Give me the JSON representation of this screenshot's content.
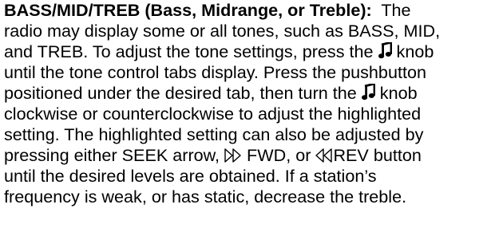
{
  "document": {
    "heading": "BASS/MID/TREB (Bass, Midrange, or Treble):",
    "line1_rest": "  The",
    "line2": "radio may display some or all tones, such as BASS, MID,",
    "line3a": "and TREB. To adjust the tone settings, press the ",
    "line3b": " knob",
    "line4": "until the tone control tabs display. Press the pushbutton",
    "line5a": "positioned under the desired tab, then turn the ",
    "line5b": " knob",
    "line6": "clockwise or counterclockwise to adjust the highlighted",
    "line7": "setting. The highlighted setting can also be adjusted by",
    "line8a": "pressing either SEEK arrow, ",
    "line8b": " FWD, or ",
    "line8c": "REV button",
    "line9": "until the desired levels are obtained. If a station’s",
    "line10": "frequency is weak, or has static, decrease the treble."
  },
  "icons": {
    "tone_knob": "music-note-icon",
    "seek_forward": "double-chevron-right-icon",
    "seek_reverse": "double-chevron-left-icon"
  }
}
